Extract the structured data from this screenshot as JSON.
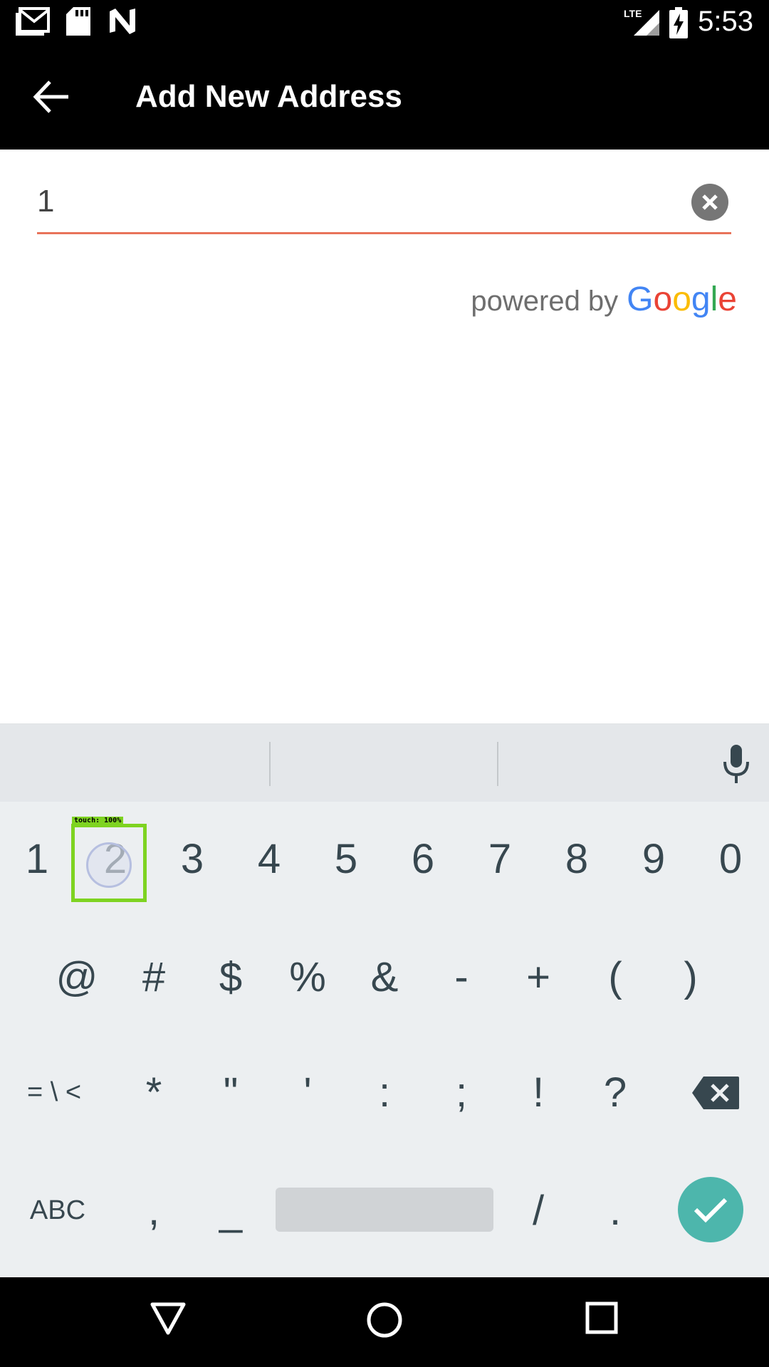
{
  "status_bar": {
    "time": "5:53",
    "network": "LTE",
    "left_icons": [
      "gmail-icon",
      "sd-card-icon",
      "n-app-icon"
    ],
    "right_icons": [
      "lte-signal-icon",
      "battery-charging-icon"
    ]
  },
  "app_bar": {
    "title": "Add New Address",
    "back_icon": "arrow-back-icon"
  },
  "search": {
    "value": "1",
    "clear_icon": "clear-circle-icon",
    "underline_color": "#e8735a"
  },
  "attribution": {
    "prefix": "powered by",
    "brand": "Google",
    "brand_colors": [
      "#4285F4",
      "#EA4335",
      "#FBBC05",
      "#4285F4",
      "#34A853",
      "#EA4335"
    ]
  },
  "keyboard": {
    "mic_icon": "mic-icon",
    "row1": [
      "1",
      "2",
      "3",
      "4",
      "5",
      "6",
      "7",
      "8",
      "9",
      "0"
    ],
    "row2": [
      "@",
      "#",
      "$",
      "%",
      "&",
      "-",
      "+",
      "(",
      ")"
    ],
    "row3": [
      "= \\ <",
      "*",
      "\"",
      "'",
      ":",
      ";",
      "!",
      "?"
    ],
    "backspace_icon": "backspace-icon",
    "row4": {
      "abc": "ABC",
      "comma": ",",
      "underscore": "_",
      "slash": "/",
      "period": "."
    },
    "enter_icon": "check-icon",
    "accent": "#4db6ac"
  },
  "touch_overlay": {
    "label": "touch: 100%",
    "color": "#7ed321"
  },
  "nav_bar": {
    "icons": [
      "back-triangle-icon",
      "home-circle-icon",
      "recents-square-icon"
    ]
  }
}
